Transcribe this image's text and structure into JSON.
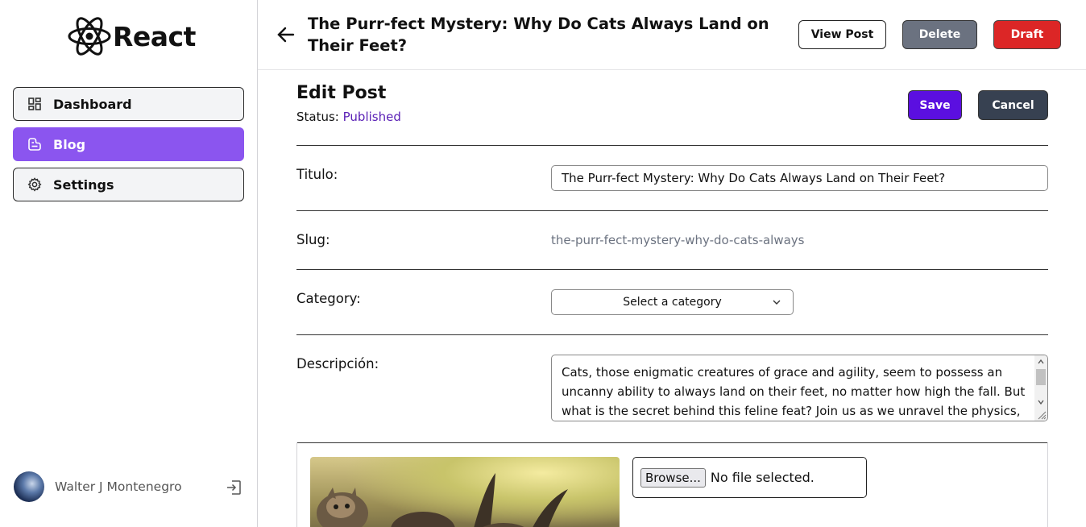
{
  "app": {
    "logo_text": "React"
  },
  "sidebar": {
    "items": [
      {
        "label": "Dashboard",
        "icon": "dashboard-icon",
        "active": false
      },
      {
        "label": "Blog",
        "icon": "blog-icon",
        "active": true
      },
      {
        "label": "Settings",
        "icon": "gear-icon",
        "active": false
      }
    ],
    "user": {
      "name": "Walter J Montenegro"
    }
  },
  "header": {
    "post_title": "The Purr-fect Mystery: Why Do Cats Always Land on Their Feet?",
    "view_label": "View Post",
    "delete_label": "Delete",
    "draft_label": "Draft"
  },
  "editor": {
    "title": "Edit Post",
    "status_label": "Status:",
    "status_value": "Published",
    "save_label": "Save",
    "cancel_label": "Cancel",
    "fields": {
      "titulo_label": "Titulo:",
      "titulo_value": "The Purr-fect Mystery: Why Do Cats Always Land on Their Feet?",
      "slug_label": "Slug:",
      "slug_value": "the-purr-fect-mystery-why-do-cats-always",
      "category_label": "Category:",
      "category_value": "Select a category",
      "descripcion_label": "Descripción:",
      "descripcion_value": "Cats, those enigmatic creatures of grace and agility, seem to possess an uncanny ability to always land on their feet, no matter how high the fall. But what is the secret behind this feline feat? Join us as we unravel the physics,"
    },
    "file": {
      "browse_label": "Browse...",
      "status_text": "No file selected."
    }
  },
  "colors": {
    "accent_purple": "#8b55ef",
    "save_purple": "#5b0fe0",
    "status_purple": "#5b21b6",
    "draft_red": "#dc2626",
    "delete_gray": "#6b7280",
    "cancel_dark": "#374151"
  }
}
